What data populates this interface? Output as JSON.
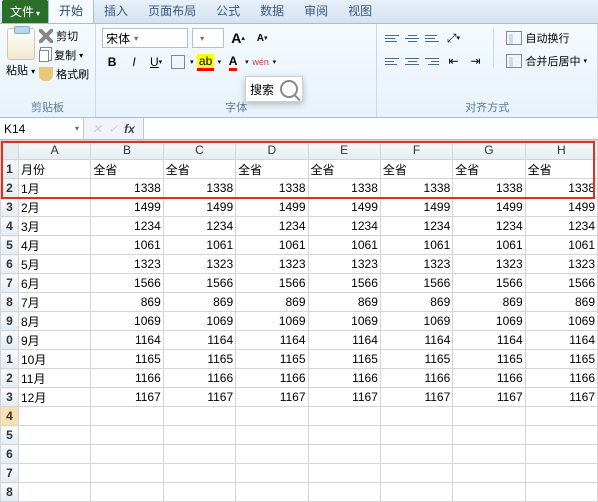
{
  "tabs": {
    "file": "文件",
    "items": [
      "开始",
      "插入",
      "页面布局",
      "公式",
      "数据",
      "审阅",
      "视图"
    ],
    "active": 0
  },
  "ribbon": {
    "clipboard": {
      "paste": "粘贴",
      "cut": "剪切",
      "copy": "复制",
      "format_painter": "格式刷",
      "group": "剪贴板"
    },
    "font": {
      "name": "宋体",
      "group": "字体"
    },
    "search_overlay": "搜索",
    "alignment": {
      "wrap": "自动换行",
      "merge": "合并后居中",
      "group": "对齐方式"
    }
  },
  "formula_bar": {
    "name_box": "K14"
  },
  "chart_data": {
    "type": "table",
    "columns": [
      "",
      "A",
      "B",
      "C",
      "D",
      "E",
      "F",
      "G",
      "H"
    ],
    "header_row": [
      "月份",
      "全省",
      "全省",
      "全省",
      "全省",
      "全省",
      "全省",
      "全省"
    ],
    "rows": [
      {
        "n": "1",
        "label": "月份",
        "vals": [
          "全省",
          "全省",
          "全省",
          "全省",
          "全省",
          "全省",
          "全省"
        ],
        "txt": true
      },
      {
        "n": "2",
        "label": "1月",
        "vals": [
          1338,
          1338,
          1338,
          1338,
          1338,
          1338,
          1338
        ]
      },
      {
        "n": "3",
        "label": "2月",
        "vals": [
          1499,
          1499,
          1499,
          1499,
          1499,
          1499,
          1499
        ]
      },
      {
        "n": "4",
        "label": "3月",
        "vals": [
          1234,
          1234,
          1234,
          1234,
          1234,
          1234,
          1234
        ]
      },
      {
        "n": "5",
        "label": "4月",
        "vals": [
          1061,
          1061,
          1061,
          1061,
          1061,
          1061,
          1061
        ]
      },
      {
        "n": "6",
        "label": "5月",
        "vals": [
          1323,
          1323,
          1323,
          1323,
          1323,
          1323,
          1323
        ]
      },
      {
        "n": "7",
        "label": "6月",
        "vals": [
          1566,
          1566,
          1566,
          1566,
          1566,
          1566,
          1566
        ]
      },
      {
        "n": "8",
        "label": "7月",
        "vals": [
          869,
          869,
          869,
          869,
          869,
          869,
          869
        ]
      },
      {
        "n": "9",
        "label": "8月",
        "vals": [
          1069,
          1069,
          1069,
          1069,
          1069,
          1069,
          1069
        ]
      },
      {
        "n": "0",
        "label": "9月",
        "vals": [
          1164,
          1164,
          1164,
          1164,
          1164,
          1164,
          1164
        ]
      },
      {
        "n": "1",
        "label": "10月",
        "vals": [
          1165,
          1165,
          1165,
          1165,
          1165,
          1165,
          1165
        ]
      },
      {
        "n": "2",
        "label": "11月",
        "vals": [
          1166,
          1166,
          1166,
          1166,
          1166,
          1166,
          1166
        ]
      },
      {
        "n": "3",
        "label": "12月",
        "vals": [
          1167,
          1167,
          1167,
          1167,
          1167,
          1167,
          1167
        ]
      }
    ],
    "empty_rows": [
      "4",
      "5",
      "6",
      "7",
      "8"
    ],
    "selected_empty": "4"
  }
}
